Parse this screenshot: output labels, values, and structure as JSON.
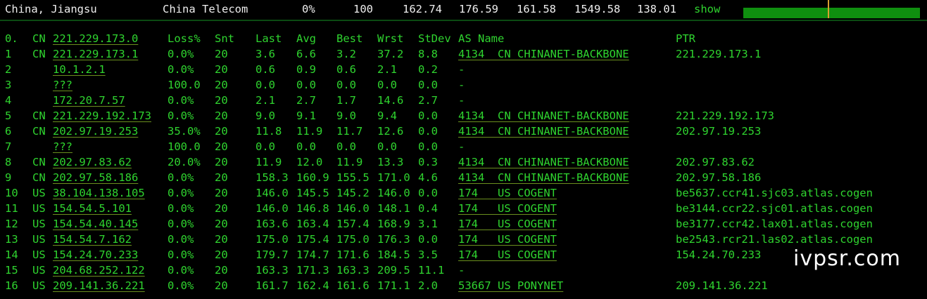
{
  "summary": {
    "location": "China, Jiangsu",
    "isp": "China Telecom",
    "loss": "0%",
    "sent": "100",
    "last": "162.74",
    "avg": "176.59",
    "best": "161.58",
    "worst": "1549.58",
    "stdev": "138.01",
    "show_label": "show",
    "bar_color": "#0f8f0f",
    "marker_color": "#d9a02d"
  },
  "columns": [
    "Loss%",
    "Snt",
    "Last",
    "Avg",
    "Best",
    "Wrst",
    "StDev",
    "AS Name",
    "PTR"
  ],
  "rows": [
    {
      "hop": "0.",
      "cc": "CN",
      "host": "221.229.173.0",
      "loss": "",
      "snt": "",
      "last": "",
      "avg": "",
      "best": "",
      "wrst": "",
      "stdev": "",
      "as": "",
      "ptr": ""
    },
    {
      "hop": "1",
      "cc": "CN",
      "host": "221.229.173.1",
      "loss": "0.0%",
      "snt": "20",
      "last": "3.6",
      "avg": "6.6",
      "best": "3.2",
      "wrst": "37.2",
      "stdev": "8.8",
      "as": "4134  CN CHINANET-BACKBONE",
      "ptr": "221.229.173.1"
    },
    {
      "hop": "2",
      "cc": "",
      "host": "10.1.2.1",
      "loss": "0.0%",
      "snt": "20",
      "last": "0.6",
      "avg": "0.9",
      "best": "0.6",
      "wrst": "2.1",
      "stdev": "0.2",
      "as": "-",
      "ptr": ""
    },
    {
      "hop": "3",
      "cc": "",
      "host": "???",
      "loss": "100.0",
      "snt": "20",
      "last": "0.0",
      "avg": "0.0",
      "best": "0.0",
      "wrst": "0.0",
      "stdev": "0.0",
      "as": "-",
      "ptr": ""
    },
    {
      "hop": "4",
      "cc": "",
      "host": "172.20.7.57",
      "loss": "0.0%",
      "snt": "20",
      "last": "2.1",
      "avg": "2.7",
      "best": "1.7",
      "wrst": "14.6",
      "stdev": "2.7",
      "as": "-",
      "ptr": ""
    },
    {
      "hop": "5",
      "cc": "CN",
      "host": "221.229.192.173",
      "loss": "0.0%",
      "snt": "20",
      "last": "9.0",
      "avg": "9.1",
      "best": "9.0",
      "wrst": "9.4",
      "stdev": "0.0",
      "as": "4134  CN CHINANET-BACKBONE",
      "ptr": "221.229.192.173"
    },
    {
      "hop": "6",
      "cc": "CN",
      "host": "202.97.19.253",
      "loss": "35.0%",
      "snt": "20",
      "last": "11.8",
      "avg": "11.9",
      "best": "11.7",
      "wrst": "12.6",
      "stdev": "0.0",
      "as": "4134  CN CHINANET-BACKBONE",
      "ptr": "202.97.19.253"
    },
    {
      "hop": "7",
      "cc": "",
      "host": "???",
      "loss": "100.0",
      "snt": "20",
      "last": "0.0",
      "avg": "0.0",
      "best": "0.0",
      "wrst": "0.0",
      "stdev": "0.0",
      "as": "-",
      "ptr": ""
    },
    {
      "hop": "8",
      "cc": "CN",
      "host": "202.97.83.62",
      "loss": "20.0%",
      "snt": "20",
      "last": "11.9",
      "avg": "12.0",
      "best": "11.9",
      "wrst": "13.3",
      "stdev": "0.3",
      "as": "4134  CN CHINANET-BACKBONE",
      "ptr": "202.97.83.62"
    },
    {
      "hop": "9",
      "cc": "CN",
      "host": "202.97.58.186",
      "loss": "0.0%",
      "snt": "20",
      "last": "158.3",
      "avg": "160.9",
      "best": "155.5",
      "wrst": "171.0",
      "stdev": "4.6",
      "as": "4134  CN CHINANET-BACKBONE",
      "ptr": "202.97.58.186"
    },
    {
      "hop": "10",
      "cc": "US",
      "host": "38.104.138.105",
      "loss": "0.0%",
      "snt": "20",
      "last": "146.0",
      "avg": "145.5",
      "best": "145.2",
      "wrst": "146.0",
      "stdev": "0.0",
      "as": "174   US COGENT",
      "ptr": "be5637.ccr41.sjc03.atlas.cogen"
    },
    {
      "hop": "11",
      "cc": "US",
      "host": "154.54.5.101",
      "loss": "0.0%",
      "snt": "20",
      "last": "146.0",
      "avg": "146.8",
      "best": "146.0",
      "wrst": "148.1",
      "stdev": "0.4",
      "as": "174   US COGENT",
      "ptr": "be3144.ccr22.sjc01.atlas.cogen"
    },
    {
      "hop": "12",
      "cc": "US",
      "host": "154.54.40.145",
      "loss": "0.0%",
      "snt": "20",
      "last": "163.6",
      "avg": "163.4",
      "best": "157.4",
      "wrst": "168.9",
      "stdev": "3.1",
      "as": "174   US COGENT",
      "ptr": "be3177.ccr42.lax01.atlas.cogen"
    },
    {
      "hop": "13",
      "cc": "US",
      "host": "154.54.7.162",
      "loss": "0.0%",
      "snt": "20",
      "last": "175.0",
      "avg": "175.4",
      "best": "175.0",
      "wrst": "176.3",
      "stdev": "0.0",
      "as": "174   US COGENT",
      "ptr": "be2543.rcr21.las02.atlas.cogen"
    },
    {
      "hop": "14",
      "cc": "US",
      "host": "154.24.70.233",
      "loss": "0.0%",
      "snt": "20",
      "last": "179.7",
      "avg": "174.7",
      "best": "171.6",
      "wrst": "184.5",
      "stdev": "3.5",
      "as": "174   US COGENT",
      "ptr": "154.24.70.233"
    },
    {
      "hop": "15",
      "cc": "US",
      "host": "204.68.252.122",
      "loss": "0.0%",
      "snt": "20",
      "last": "163.3",
      "avg": "171.3",
      "best": "163.3",
      "wrst": "209.5",
      "stdev": "11.1",
      "as": "-",
      "ptr": ""
    },
    {
      "hop": "16",
      "cc": "US",
      "host": "209.141.36.221",
      "loss": "0.0%",
      "snt": "20",
      "last": "161.7",
      "avg": "162.4",
      "best": "161.6",
      "wrst": "171.1",
      "stdev": "2.0",
      "as": "53667 US PONYNET",
      "ptr": "209.141.36.221"
    }
  ],
  "watermark": "ivpsr.com",
  "colors": {
    "background": "#000000",
    "text": "#2fd42f",
    "header_text": "#eeeeee",
    "link_underline": "#6a8f1e"
  }
}
